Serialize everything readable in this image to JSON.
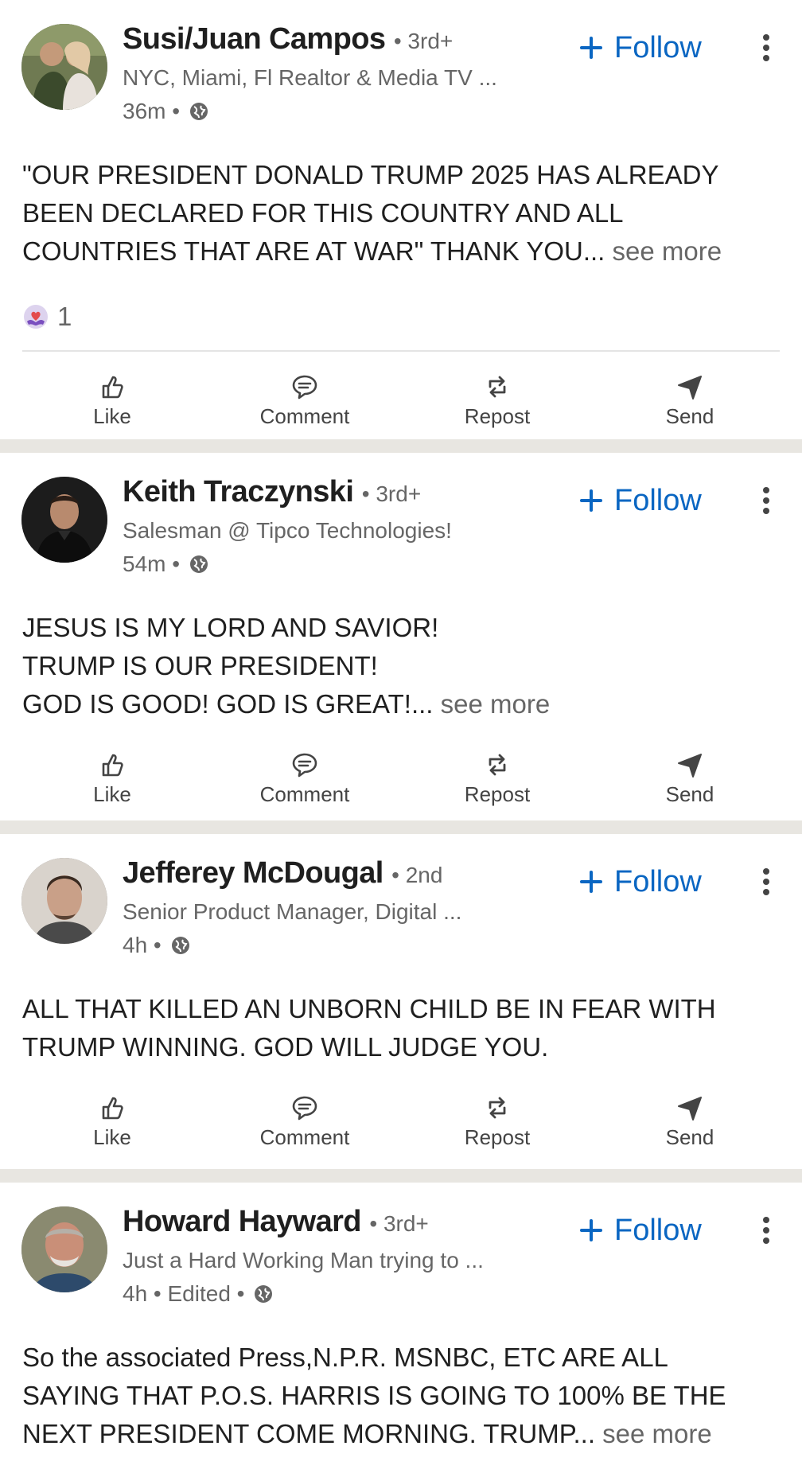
{
  "colors": {
    "accent": "#0a66c2",
    "secondary_text": "#666666",
    "primary_text": "#1f1f1f",
    "separator": "#e8e6e1"
  },
  "action_labels": {
    "like": "Like",
    "comment": "Comment",
    "repost": "Repost",
    "send": "Send"
  },
  "follow_label": "Follow",
  "see_more_label": "see more",
  "posts": [
    {
      "author": "Susi/Juan Campos",
      "degree": "• 3rd+",
      "subtitle": "NYC, Miami, Fl Realtor & Media TV ...",
      "time": "36m •",
      "text": "\"OUR PRESIDENT DONALD TRUMP 2025 HAS ALREADY\nBEEN DECLARED FOR THIS COUNTRY AND ALL\nCOUNTRIES THAT ARE AT WAR\" THANK YOU...",
      "reaction_count": "1",
      "avatar_icon": "couple-photo-avatar"
    },
    {
      "author": "Keith Traczynski",
      "degree": "• 3rd+",
      "subtitle": "Salesman @ Tipco Technologies!",
      "time": "54m •",
      "text": "JESUS IS MY LORD AND SAVIOR!\nTRUMP IS OUR PRESIDENT!\nGOD IS GOOD! GOD IS GREAT!...",
      "avatar_icon": "man-dark-photo-avatar"
    },
    {
      "author": "Jefferey McDougal",
      "degree": "• 2nd",
      "subtitle": "Senior Product Manager, Digital ...",
      "time": "4h •",
      "text": "ALL THAT KILLED AN UNBORN CHILD BE IN FEAR WITH\nTRUMP WINNING. GOD WILL JUDGE YOU.",
      "avatar_icon": "man-portrait-avatar"
    },
    {
      "author": "Howard Hayward",
      "degree": "• 3rd+",
      "subtitle": "Just a Hard Working Man trying to ...",
      "time": "4h • Edited •",
      "text": "So the associated Press,N.P.R. MSNBC, ETC ARE ALL\nSAYING THAT P.O.S. HARRIS IS GOING TO 100% BE THE\nNEXT PRESIDENT COME MORNING. TRUMP...",
      "avatar_icon": "older-man-photo-avatar"
    }
  ]
}
